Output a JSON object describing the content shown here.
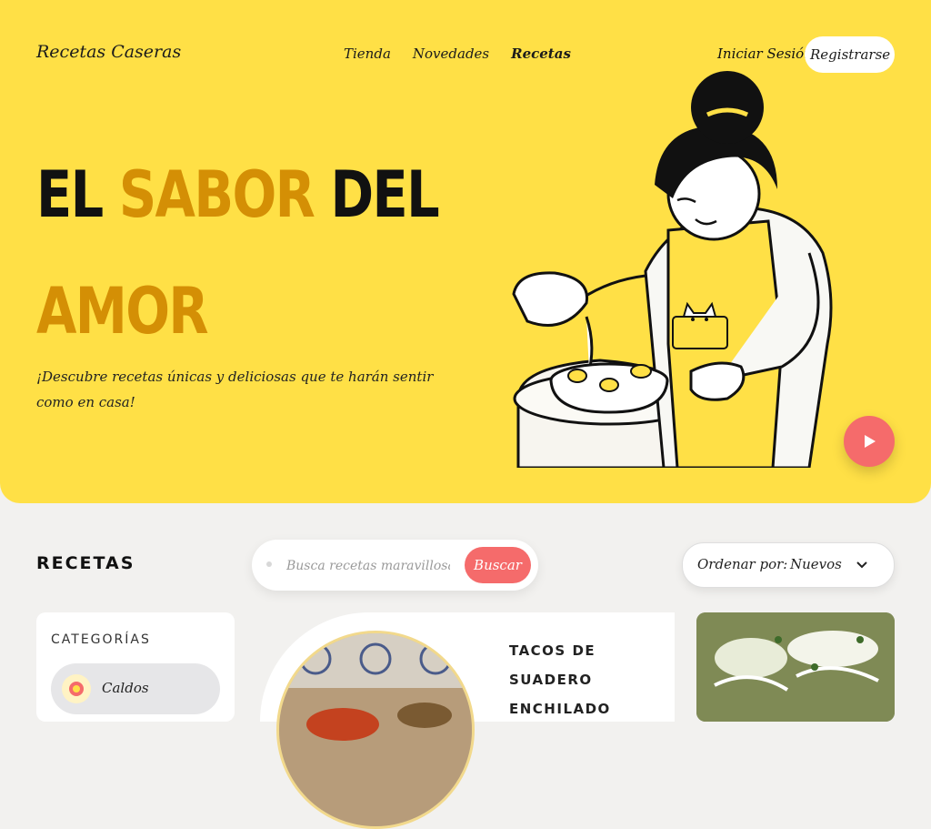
{
  "header": {
    "brand": "Recetas Caseras",
    "nav": [
      "Tienda",
      "Novedades",
      "Recetas"
    ],
    "active_nav": "Recetas",
    "login": "Iniciar Sesión",
    "register": "Registrarse"
  },
  "hero": {
    "headline_part1": "El",
    "headline_accent1": "sabor",
    "headline_part2": "del",
    "headline_accent2": "amor",
    "tagline": "¡Descubre recetas únicas y deliciosas que te harán sentir como en casa!",
    "play_icon": "play-icon"
  },
  "recipes": {
    "title": "Recetas",
    "search_placeholder": "Busca recetas maravillosas...",
    "search_value": "",
    "search_button": "Buscar",
    "sort_label": "Ordenar por:",
    "sort_value": "Nuevos"
  },
  "categories": {
    "title": "Categorías",
    "items": [
      {
        "label": "Caldos",
        "icon": "bowl-icon"
      }
    ]
  },
  "featured": {
    "title": "Tacos de Suadero Enchilado"
  },
  "colors": {
    "hero_bg": "#ffe046",
    "accent": "#d48f05",
    "button": "#f56b6b",
    "page_bg": "#f2f1ef"
  }
}
